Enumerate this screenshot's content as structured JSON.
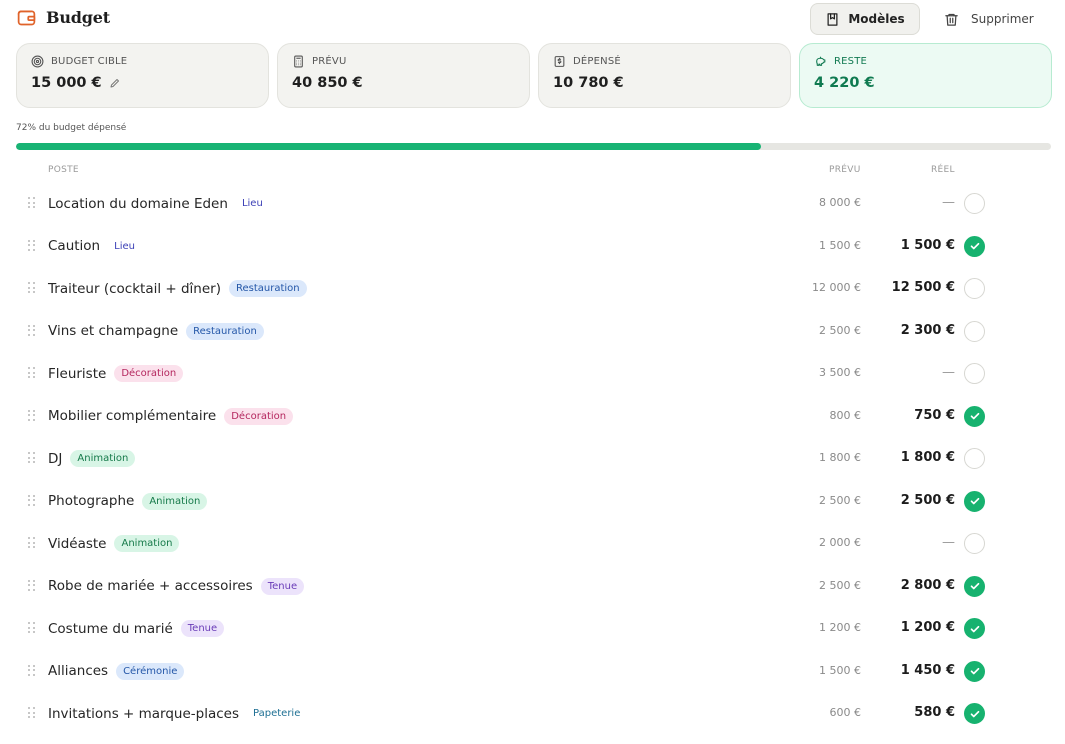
{
  "header": {
    "title": "Budget",
    "templates_label": "Modèles",
    "delete_label": "Supprimer"
  },
  "cards": {
    "target": {
      "label": "BUDGET CIBLE",
      "value": "15 000 €"
    },
    "planned": {
      "label": "PRÉVU",
      "value": "40 850 €"
    },
    "spent": {
      "label": "DÉPENSÉ",
      "value": "10 780 €"
    },
    "remaining": {
      "label": "RESTE",
      "value": "4 220 €"
    }
  },
  "progress": {
    "label": "72% du budget dépensé",
    "percent": 72
  },
  "table": {
    "col_item": "POSTE",
    "col_planned": "PRÉVU",
    "col_actual": "RÉEL",
    "rows": [
      {
        "label": "Location du domaine Eden",
        "tag": "Lieu",
        "planned": "8 000 €",
        "actual": "—",
        "paid": false
      },
      {
        "label": "Caution",
        "tag": "Lieu",
        "planned": "1 500 €",
        "actual": "1 500 €",
        "paid": true
      },
      {
        "label": "Traiteur (cocktail + dîner)",
        "tag": "Restauration",
        "planned": "12 000 €",
        "actual": "12 500 €",
        "paid": false
      },
      {
        "label": "Vins et champagne",
        "tag": "Restauration",
        "planned": "2 500 €",
        "actual": "2 300 €",
        "paid": false
      },
      {
        "label": "Fleuriste",
        "tag": "Décoration",
        "planned": "3 500 €",
        "actual": "—",
        "paid": false
      },
      {
        "label": "Mobilier complémentaire",
        "tag": "Décoration",
        "planned": "800 €",
        "actual": "750 €",
        "paid": true
      },
      {
        "label": "DJ",
        "tag": "Animation",
        "planned": "1 800 €",
        "actual": "1 800 €",
        "paid": false
      },
      {
        "label": "Photographe",
        "tag": "Animation",
        "planned": "2 500 €",
        "actual": "2 500 €",
        "paid": true
      },
      {
        "label": "Vidéaste",
        "tag": "Animation",
        "planned": "2 000 €",
        "actual": "—",
        "paid": false
      },
      {
        "label": "Robe de mariée + accessoires",
        "tag": "Tenue",
        "planned": "2 500 €",
        "actual": "2 800 €",
        "paid": true
      },
      {
        "label": "Costume du marié",
        "tag": "Tenue",
        "planned": "1 200 €",
        "actual": "1 200 €",
        "paid": true
      },
      {
        "label": "Alliances",
        "tag": "Cérémonie",
        "planned": "1 500 €",
        "actual": "1 450 €",
        "paid": true
      },
      {
        "label": "Invitations + marque-places",
        "tag": "Papeterie",
        "planned": "600 €",
        "actual": "580 €",
        "paid": true
      }
    ]
  },
  "tag_styles": {
    "Lieu": {
      "bg": "transparent",
      "fg": "#3b3fb6"
    },
    "Restauration": {
      "bg": "#dbe8fb",
      "fg": "#2457a8"
    },
    "Décoration": {
      "bg": "#fbe1ec",
      "fg": "#b4265e"
    },
    "Animation": {
      "bg": "#d8f5e6",
      "fg": "#167a4a"
    },
    "Tenue": {
      "bg": "#ece3fb",
      "fg": "#6a3cb8"
    },
    "Cérémonie": {
      "bg": "#dbe8fb",
      "fg": "#2457a8"
    },
    "Papeterie": {
      "bg": "transparent",
      "fg": "#1d6f93"
    }
  },
  "colors": {
    "accent": "#18b374",
    "brand_icon": "#e0632a"
  }
}
